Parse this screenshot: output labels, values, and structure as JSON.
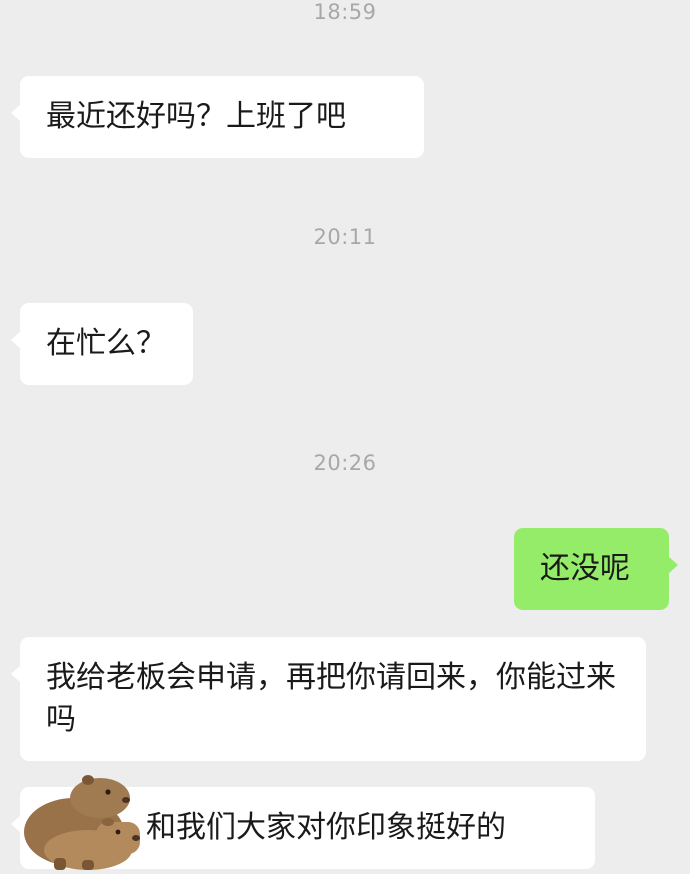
{
  "timestamps": [
    "18:59",
    "20:11",
    "20:26"
  ],
  "messages": [
    {
      "side": "left",
      "text": "最近还好吗？上班了吧"
    },
    {
      "side": "left",
      "text": "在忙么？"
    },
    {
      "side": "right",
      "text": "还没呢"
    },
    {
      "side": "left",
      "text": "我给老板会申请，再把你请回来，你能过来吗"
    },
    {
      "side": "left",
      "text": "和我们大家对你印象挺好的"
    }
  ],
  "sticker": {
    "icon": "capybara-icon"
  },
  "colors": {
    "background": "#ededed",
    "incoming_bubble": "#ffffff",
    "outgoing_bubble": "#95ec69",
    "timestamp": "#a8a8a8"
  }
}
